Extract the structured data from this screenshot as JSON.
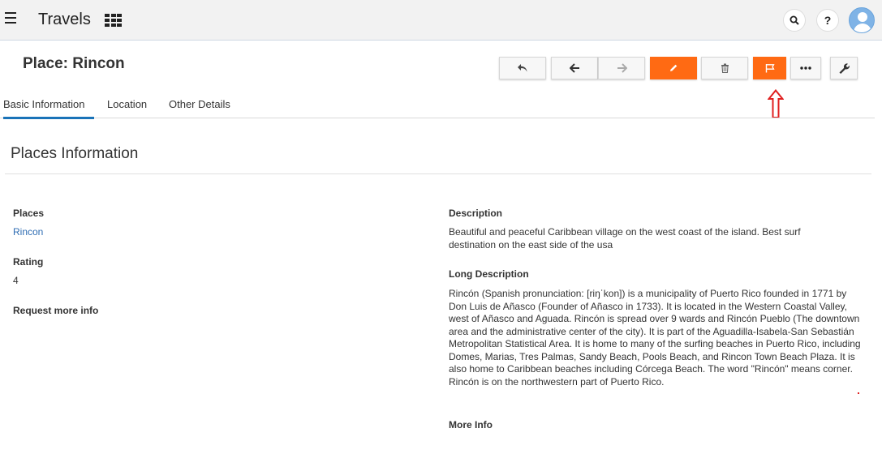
{
  "app": {
    "title": "Travels"
  },
  "icons": {
    "menu": "hamburger-icon",
    "apps": "grid-icon",
    "search": "search-icon",
    "help": "help-icon",
    "user": "avatar-icon"
  },
  "header": {
    "help_label": "?",
    "title": "Place: Rincon"
  },
  "toolbar": {
    "buttons": [
      "reply-icon",
      "arrow-left-icon",
      "arrow-right-icon",
      "pencil-icon",
      "trash-icon",
      "flag-icon",
      "more-icon",
      "wrench-icon"
    ],
    "accent_color": "#ff6a13"
  },
  "tabs": [
    {
      "label": "Basic Information",
      "active": true
    },
    {
      "label": "Location",
      "active": false
    },
    {
      "label": "Other Details",
      "active": false
    }
  ],
  "section": {
    "title": "Places Information"
  },
  "fields": {
    "places_label": "Places",
    "places_value": "Rincon",
    "rating_label": "Rating",
    "rating_value": "4",
    "request_label": "Request more info",
    "description_label": "Description",
    "description_value": "Beautiful and peaceful Caribbean village on the west coast of the island. Best surf destination on the east side of the usa",
    "long_description_label": "Long Description",
    "long_description_value": "Rincón (Spanish pronunciation: [riŋˈkon]) is a municipality of Puerto Rico founded in 1771 by Don Luis de Añasco (Founder of Añasco in 1733). It is located in the Western Coastal Valley, west of Añasco and Aguada. Rincón is spread over 9 wards and Rincón Pueblo (The downtown area and the administrative center of the city). It is part of the Aguadilla-Isabela-San Sebastián Metropolitan Statistical Area. It is home to many of the surfing beaches in Puerto Rico, including Domes, Marias, Tres Palmas, Sandy Beach, Pools Beach, and Rincon Town Beach Plaza. It is also home to Caribbean beaches including Córcega Beach. The word \"Rincón\" means corner. Rincón is on the northwestern part of Puerto Rico.",
    "more_info_label": "More Info"
  }
}
